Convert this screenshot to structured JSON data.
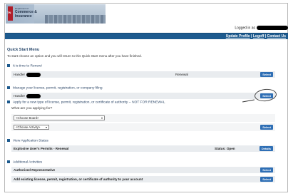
{
  "header": {
    "logo_text": "TN",
    "dept_small": "Department of",
    "dept_line1": "Commerce &",
    "dept_line2": "Insurance",
    "logged_in_label": "Logged in as"
  },
  "nav": {
    "update_profile": "Update Profile",
    "sep1": " | ",
    "logoff": "Logoff",
    "sep2": " | ",
    "contact_us": "Contact Us"
  },
  "quick_start": {
    "title": "Quick Start Menu",
    "subtitle": "To start choose an option and you will return to this Quick Start menu after you have finished."
  },
  "renew": {
    "heading": "It is time to Renew!",
    "handler_label": "Handler",
    "type": "Renewal",
    "button": "Select"
  },
  "manage": {
    "heading": "Manage your license, permit, registration, or company filing",
    "handler_label": "Handler",
    "button": "Select"
  },
  "apply": {
    "heading": "Apply for a new type of license, permit, registration, or certificate of authority -- NOT FOR RENEWAL",
    "question": "What are you applying for?",
    "board_placeholder": "<Choose Board>",
    "activity_placeholder": "<Choose Activity>",
    "button": "Select"
  },
  "status": {
    "heading": "View Application Status",
    "item": "Explosive User's Permits - Renewal",
    "status_label": "Status: Open",
    "button": "Details"
  },
  "additional": {
    "heading": "Additional Activities",
    "rows": [
      {
        "label": "Authorized Representative",
        "button": "Select"
      },
      {
        "label": "Add existing license, permit, registration, or certificate of authority to your account",
        "button": "Select"
      }
    ]
  }
}
